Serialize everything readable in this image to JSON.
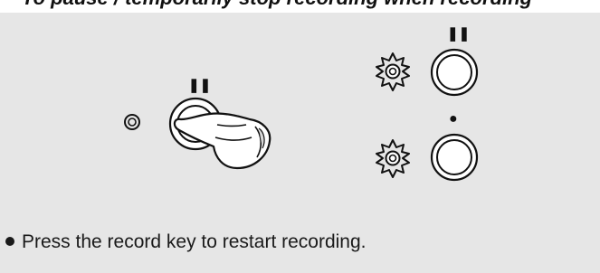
{
  "heading": {
    "text": "To pause / temporarily stop recording when recording"
  },
  "illustration": {
    "pause_symbol": "❚❚",
    "record_symbol": "●",
    "left_group": {
      "indicator_icon": "indicator-lamp-icon",
      "button_icon": "pause-button-icon",
      "hand_icon": "pressing-finger-icon"
    },
    "right_group": {
      "top_row": {
        "indicator_icon": "blinking-lamp-icon",
        "button_icon": "pause-button-icon"
      },
      "bottom_row": {
        "indicator_icon": "blinking-lamp-icon",
        "button_icon": "record-button-icon"
      }
    }
  },
  "note": {
    "text": "Press the record key to restart recording."
  },
  "colors": {
    "panel_background": "#e6e6e6",
    "ink": "#1a1a1a"
  }
}
